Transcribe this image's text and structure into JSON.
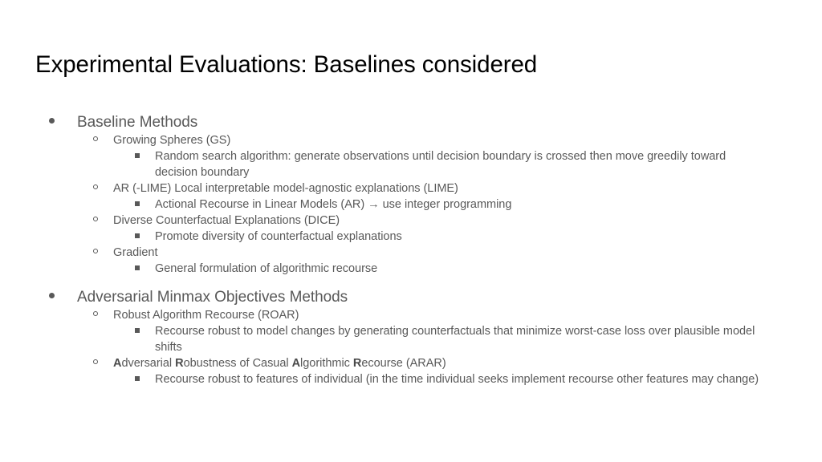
{
  "slide": {
    "title": "Experimental Evaluations: Baselines considered",
    "title_color": "#000000",
    "body_color": "#595959",
    "background_color": "#ffffff"
  },
  "outline": {
    "sections": [
      {
        "label": "Baseline Methods",
        "items": [
          {
            "label": "Growing Spheres (GS)",
            "details": [
              "Random search algorithm: generate observations until decision boundary is crossed then move greedily toward decision boundary"
            ]
          },
          {
            "label": "AR (-LIME) Local interpretable model-agnostic explanations (LIME)",
            "details": [
              "Actional Recourse in Linear Models (AR) → use integer programming"
            ]
          },
          {
            "label": "Diverse Counterfactual Explanations (DICE)",
            "details": [
              "Promote diversity of counterfactual explanations"
            ]
          },
          {
            "label": "Gradient",
            "details": [
              "General formulation of algorithmic recourse"
            ]
          }
        ]
      },
      {
        "label": "Adversarial Minmax Objectives Methods",
        "items": [
          {
            "label": "Robust Algorithm Recourse (ROAR)",
            "details": [
              "Recourse robust to model changes by generating counterfactuals that minimize worst-case loss over plausible model shifts"
            ]
          },
          {
            "label_html": "<b class=\"em\">A</b>dversarial <b class=\"em\">R</b>obustness of Casual <b class=\"em\">A</b>lgorithmic <b class=\"em\">R</b>ecourse (ARAR)",
            "label": "Adversarial Robustness of Casual Algorithmic Recourse (ARAR)",
            "details": [
              "Recourse robust to features of individual (in the time individual seeks implement recourse other features may change)"
            ]
          }
        ]
      }
    ]
  },
  "markers": {
    "level1": "filled-disc-bullet",
    "level2": "hollow-circle-bullet",
    "level3": "filled-square-bullet"
  }
}
